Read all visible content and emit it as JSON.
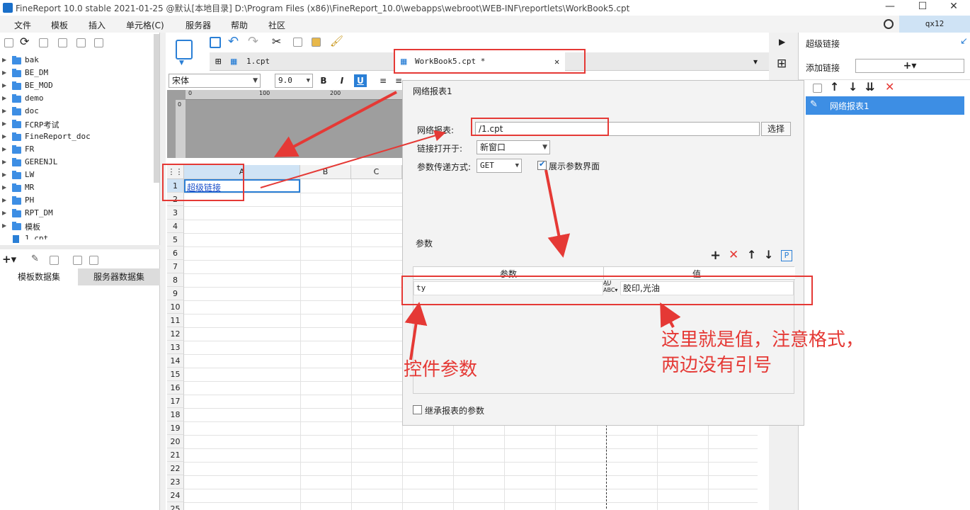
{
  "window": {
    "title": "FineReport 10.0 stable 2021-01-25 @默认[本地目录]    D:\\Program Files (x86)\\FineReport_10.0\\webapps\\webroot\\WEB-INF\\reportlets\\WorkBook5.cpt",
    "minimize": "—",
    "maximize": "☐",
    "close": "✕",
    "user": "qx12"
  },
  "menu": [
    "文件",
    "模板",
    "插入",
    "单元格(C)",
    "服务器",
    "帮助",
    "社区"
  ],
  "left_tree": [
    "bak",
    "BE_DM",
    "BE_MOD",
    "demo",
    "doc",
    "FCRP考试",
    "FineReport_doc",
    "FR",
    "GERENJL",
    "LW",
    "MR",
    "PH",
    "RPT_DM",
    "模板",
    "1.cpt"
  ],
  "left_tabs": {
    "template_dataset": "模板数据集",
    "server_dataset": "服务器数据集"
  },
  "tabs": {
    "tab1": "1.cpt",
    "tab2": "WorkBook5.cpt *"
  },
  "format": {
    "font": "宋体",
    "size": "9.0"
  },
  "ruler": {
    "m0": "0",
    "m100": "100",
    "m200": "200"
  },
  "columns": [
    "A",
    "B",
    "C"
  ],
  "rows": [
    "1",
    "2",
    "3",
    "4",
    "5",
    "6",
    "7",
    "8",
    "9",
    "10",
    "11",
    "12",
    "13",
    "14",
    "15",
    "16",
    "17",
    "18",
    "19",
    "20",
    "21",
    "22",
    "23",
    "24",
    "25"
  ],
  "cell_a1": "超级链接",
  "dialog": {
    "title": "网络报表1",
    "report_label": "网络报表:",
    "report_value": "/1.cpt",
    "choose_button": "选择",
    "open_label": "链接打开于:",
    "open_value": "新窗口",
    "method_label": "参数传递方式:",
    "method_value": "GET",
    "show_param_label": "展示参数界面",
    "params_title": "参数",
    "col_param": "参数",
    "col_value": "值",
    "param_name": "ty",
    "param_value": "胶印,光油",
    "inherit_label": "继承报表的参数"
  },
  "right_panel": {
    "title": "超级链接",
    "add_label": "添加链接",
    "add_button": "+▾",
    "item": "网络报表1"
  },
  "annotations": {
    "control_param": "控件参数",
    "value_note_line1": "这里就是值，注意格式，",
    "value_note_line2": "两边没有引号"
  },
  "colors": {
    "accent": "#1a6fc9",
    "annotation": "#e53935",
    "selected": "#3d8ee4"
  }
}
